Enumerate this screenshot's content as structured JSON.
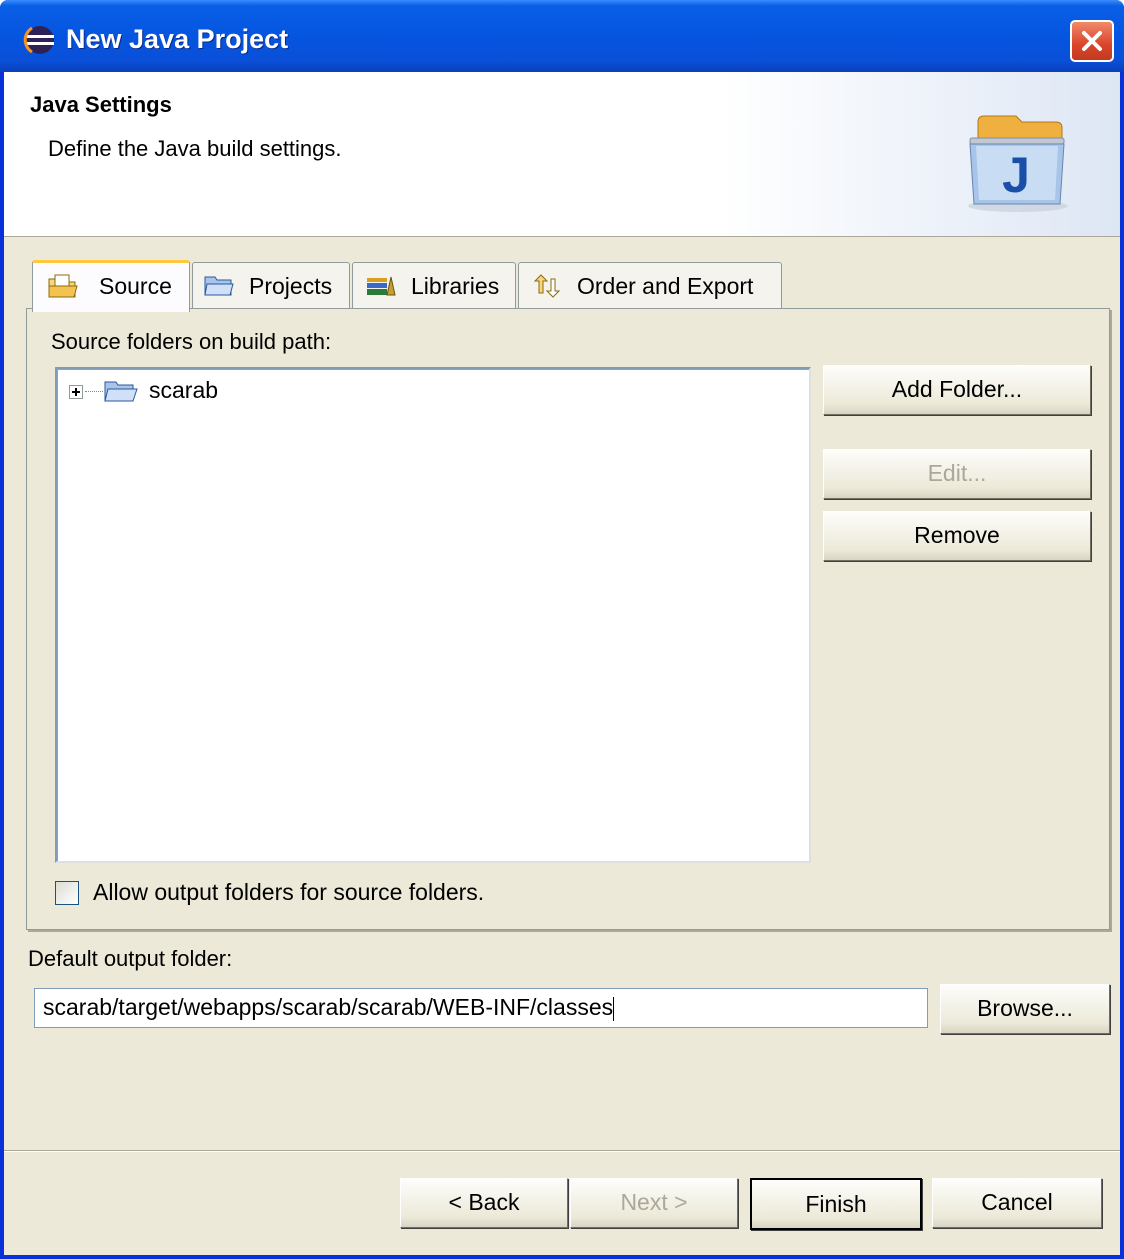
{
  "window": {
    "title": "New Java Project",
    "close_label": "close"
  },
  "header": {
    "title": "Java Settings",
    "description": "Define the Java build settings.",
    "icon_letter": "J"
  },
  "tabs": [
    {
      "label": "Source",
      "icon": "source-folder-icon",
      "active": true
    },
    {
      "label": "Projects",
      "icon": "projects-folder-icon",
      "active": false
    },
    {
      "label": "Libraries",
      "icon": "libraries-icon",
      "active": false
    },
    {
      "label": "Order and Export",
      "icon": "order-export-icon",
      "active": false
    }
  ],
  "source_tab": {
    "list_label": "Source folders on build path:",
    "tree_items": [
      {
        "label": "scarab",
        "expandable": true
      }
    ],
    "buttons": {
      "add_folder": "Add Folder...",
      "edit": "Edit...",
      "remove": "Remove"
    },
    "allow_output_checkbox": {
      "label": "Allow output folders for source folders.",
      "checked": false
    }
  },
  "output": {
    "label": "Default output folder:",
    "value": "scarab/target/webapps/scarab/scarab/WEB-INF/classes",
    "browse_label": "Browse..."
  },
  "footer": {
    "back_label": "< Back",
    "next_label": "Next >",
    "finish_label": "Finish",
    "cancel_label": "Cancel"
  },
  "colors": {
    "title_bar": "#0555e0",
    "dialog_bg": "#ece9d8",
    "active_tab_accent": "#ffc83c"
  }
}
